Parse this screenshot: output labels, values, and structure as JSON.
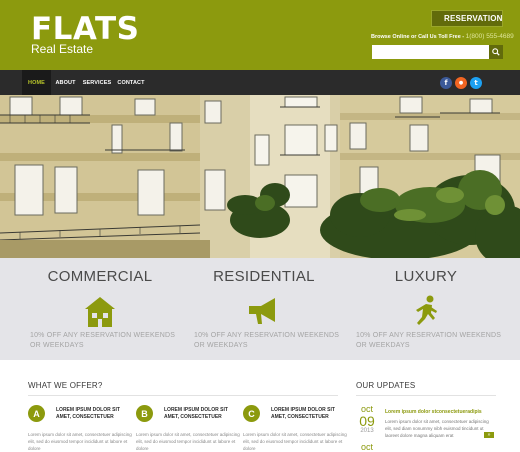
{
  "brand": {
    "name": "FLATS",
    "tagline": "Real Estate"
  },
  "header": {
    "reservation_label": "RESERVATION",
    "contact_text": "Browse Online or Call Us Toll Free - ",
    "phone": "1(800) 555-4689",
    "search_placeholder": ""
  },
  "nav": {
    "items": [
      {
        "label": "HOME",
        "active": true
      },
      {
        "label": "ABOUT",
        "active": false
      },
      {
        "label": "SERVICES",
        "active": false
      },
      {
        "label": "CONTACT",
        "active": false
      }
    ]
  },
  "social": [
    {
      "name": "facebook",
      "glyph": "f",
      "color": "#3b5998"
    },
    {
      "name": "rss",
      "glyph": "●",
      "color": "#f26522"
    },
    {
      "name": "twitter",
      "glyph": "t",
      "color": "#1da1f2"
    }
  ],
  "features": [
    {
      "title": "COMMERCIAL",
      "icon": "house-icon",
      "text": "10% OFF ANY RESERVATION WEEKENDS OR WEEKDAYS"
    },
    {
      "title": "RESIDENTIAL",
      "icon": "megaphone-icon",
      "text": "10% OFF ANY RESERVATION WEEKENDS OR WEEKDAYS"
    },
    {
      "title": "LUXURY",
      "icon": "walking-person-icon",
      "text": "10% OFF ANY RESERVATION WEEKENDS OR WEEKDAYS"
    }
  ],
  "offer": {
    "title": "WHAT WE OFFER?",
    "items": [
      {
        "badge": "A",
        "heading": "LOREM IPSUM DOLOR SIT AMET, CONSECTETUER",
        "text": "Lorem ipsum dolor sit amet, consectetuer adipiscing elit, sed do eiusmod tempor incididunt ut labore et dolore"
      },
      {
        "badge": "B",
        "heading": "LOREM IPSUM DOLOR SIT AMET, CONSECTETUER",
        "text": "Lorem ipsum dolor sit amet, consectetuer adipiscing elit, sed do eiusmod tempor incididunt ut labore et dolore"
      },
      {
        "badge": "C",
        "heading": "LOREM IPSUM DOLOR SIT AMET, CONSECTETUER",
        "text": "Lorem ipsum dolor sit amet, consectetuer adipiscing elit, sed do eiusmod tempor incididunt ut labore et dolore"
      }
    ]
  },
  "updates": {
    "title": "OUR UPDATES",
    "items": [
      {
        "month": "oct",
        "day": "09",
        "year": "2013",
        "heading": "Lorem ipsum dolor stconsectetueradipis",
        "text": "Lorem ipsum dolor sit amet, consectetuer adipiscing elit, sed diam nonummy nibh euismod tincidunt ut laoreet dolore magna aliquam erat",
        "more": "»"
      },
      {
        "month": "oct",
        "day": "",
        "year": "",
        "heading": "",
        "text": "",
        "more": ""
      }
    ]
  },
  "colors": {
    "accent": "#8c9a0e",
    "accent_dark": "#626b0b",
    "nav_bg": "#2b2b2b"
  }
}
